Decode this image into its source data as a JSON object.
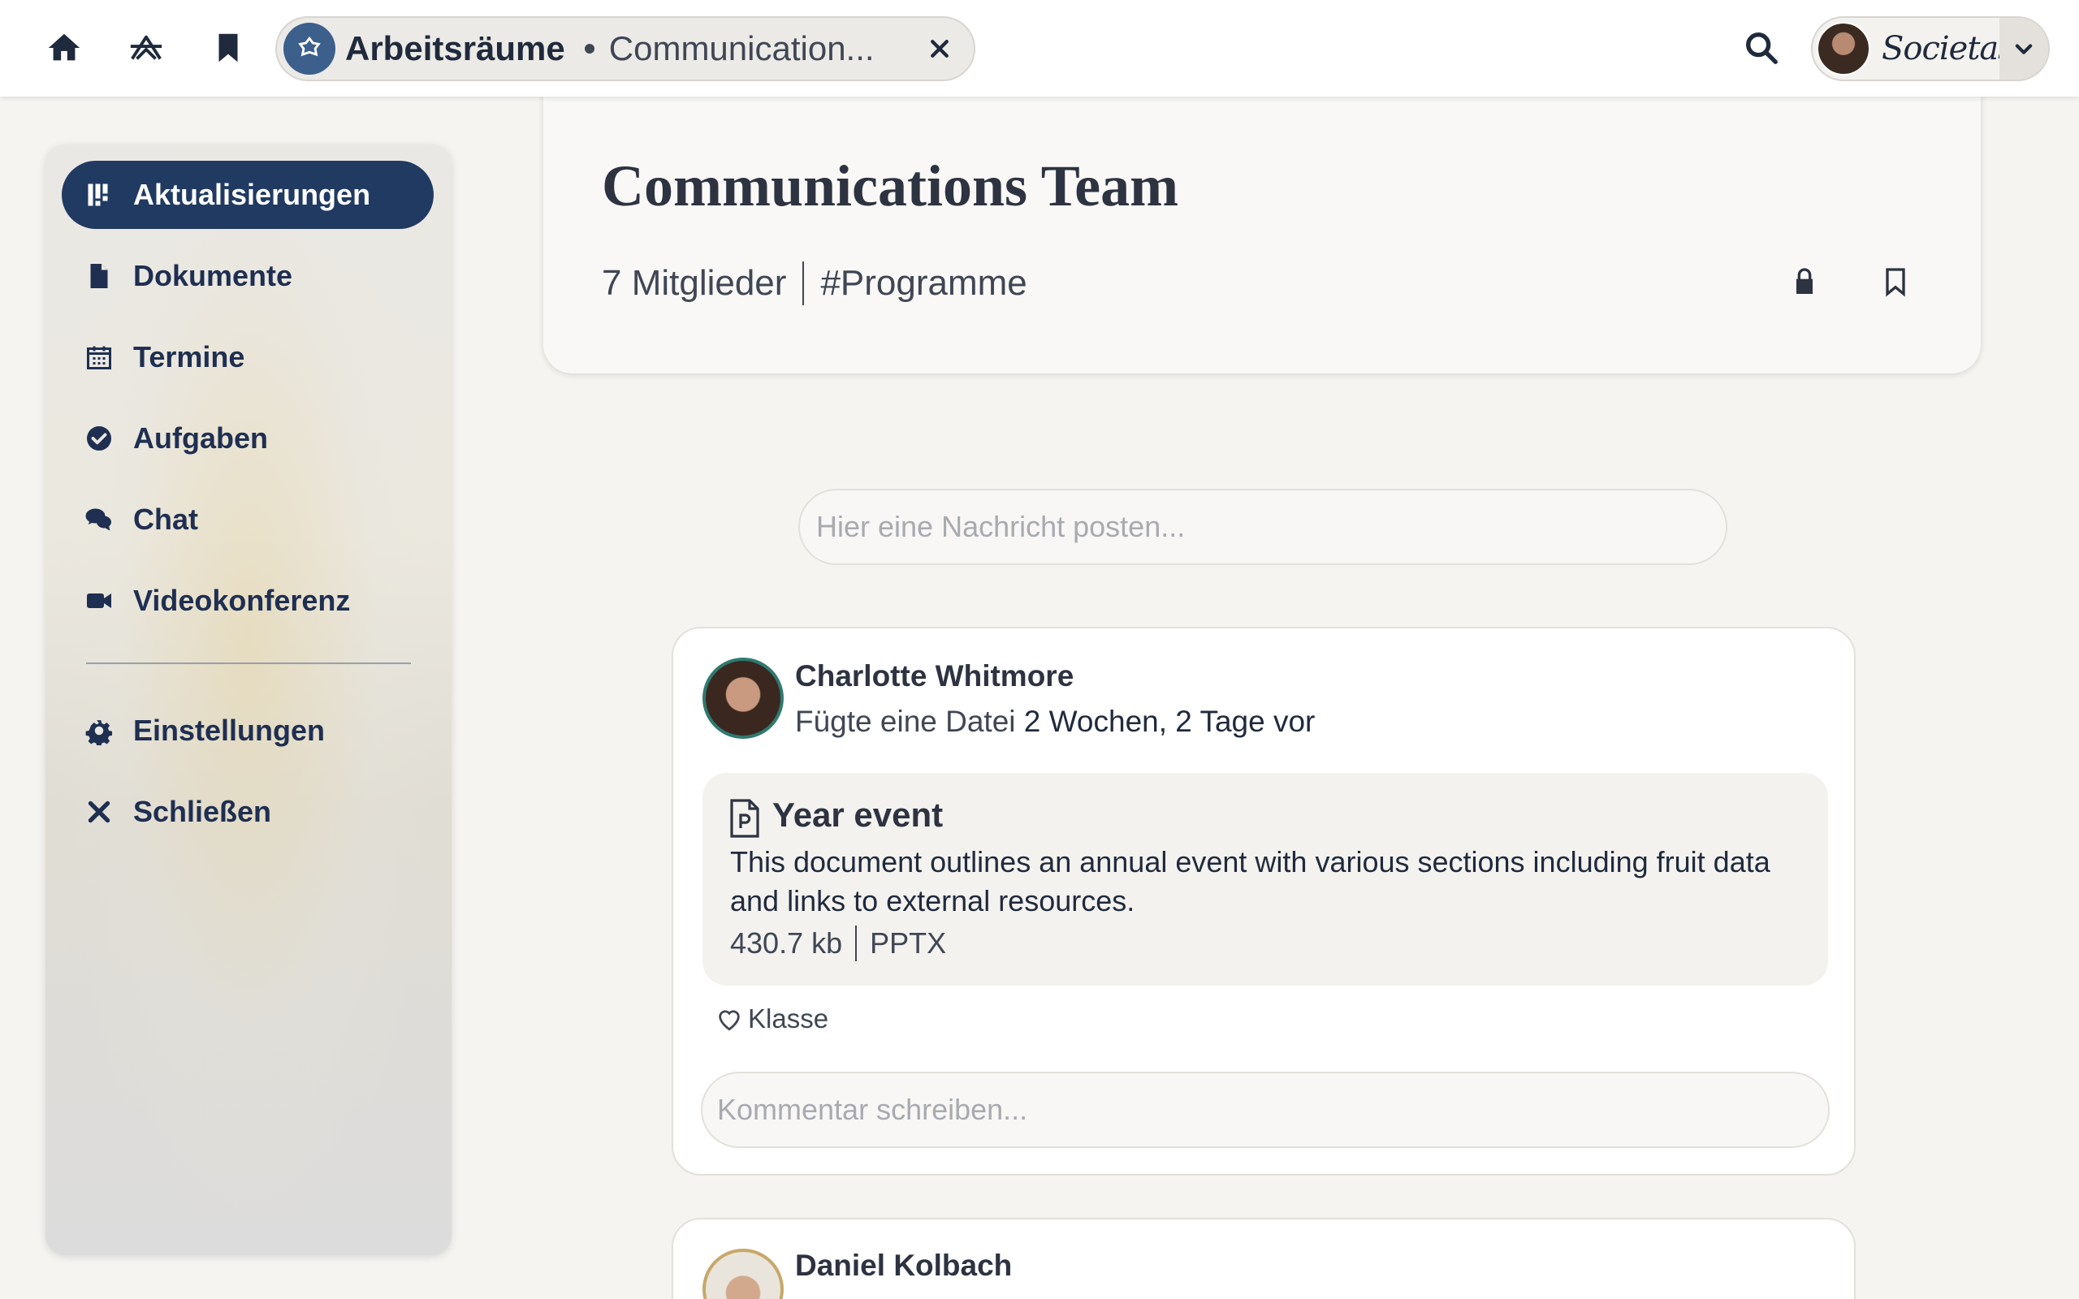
{
  "topbar": {
    "icons": [
      "home-icon",
      "apps-icon",
      "bookmark-icon"
    ],
    "breadcrumb": {
      "title": "Arbeitsräume",
      "subtitle": "Communication..."
    },
    "brand": "Societas"
  },
  "sidebar": {
    "items": [
      {
        "label": "Aktualisierungen",
        "icon": "updates-icon",
        "active": true
      },
      {
        "label": "Dokumente",
        "icon": "document-icon"
      },
      {
        "label": "Termine",
        "icon": "calendar-icon"
      },
      {
        "label": "Aufgaben",
        "icon": "check-circle-icon"
      },
      {
        "label": "Chat",
        "icon": "chat-icon"
      },
      {
        "label": "Videokonferenz",
        "icon": "video-icon"
      },
      {
        "label": "Einstellungen",
        "icon": "gear-icon"
      },
      {
        "label": "Schließen",
        "icon": "close-icon"
      }
    ]
  },
  "header": {
    "title": "Communications Team",
    "members": "7 Mitglieder",
    "tag": "#Programme"
  },
  "composer": {
    "placeholder": "Hier eine Nachricht posten..."
  },
  "posts": [
    {
      "author": "Charlotte Whitmore",
      "action": "Fügte eine Datei",
      "time": "2 Wochen, 2 Tage vor",
      "file": {
        "title": "Year event",
        "description": "This document outlines an annual event with various sections including fruit data and links to external resources.",
        "size": "430.7 kb",
        "type": "PPTX"
      },
      "like_label": "Klasse",
      "comment_placeholder": "Kommentar schreiben..."
    },
    {
      "author": "Daniel Kolbach"
    }
  ],
  "colors": {
    "accent": "#203a62",
    "background": "#f6f4f1",
    "avatar_ring": "#2f7a6f"
  }
}
